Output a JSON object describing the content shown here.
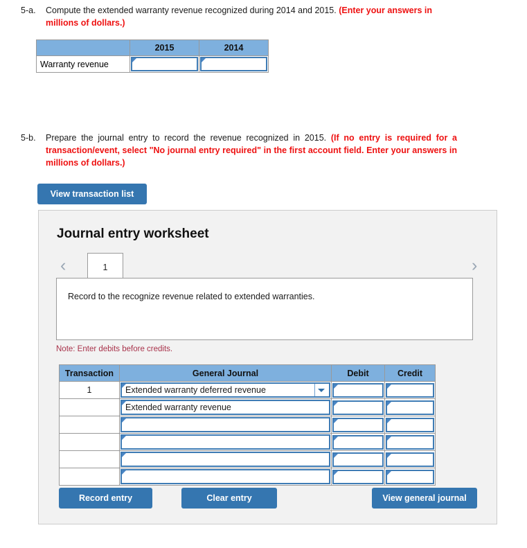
{
  "questions": {
    "q5a": {
      "label": "5-a.",
      "text": "Compute the extended warranty revenue recognized during 2014 and 2015. ",
      "instruction": "(Enter your answers in millions of dollars.)"
    },
    "q5b": {
      "label": "5-b.",
      "text": "Prepare the journal entry to record the revenue recognized in 2015. ",
      "instruction": "(If no entry is required for a transaction/event, select \"No journal entry required\" in the first account field. Enter your answers in millions of dollars.)"
    }
  },
  "warranty_table": {
    "corner_header": "",
    "headers": [
      "2015",
      "2014"
    ],
    "rows": [
      {
        "label": "Warranty revenue",
        "values": [
          "",
          ""
        ]
      }
    ]
  },
  "buttons": {
    "view_transaction_list": "View transaction list",
    "record_entry": "Record entry",
    "clear_entry": "Clear entry",
    "view_general_journal": "View general journal"
  },
  "worksheet": {
    "title": "Journal entry worksheet",
    "prev_icon": "‹",
    "next_icon": "›",
    "tabs": [
      "1"
    ],
    "active_tab": "1",
    "description": "Record to the recognize revenue related to extended warranties.",
    "note": "Note: Enter debits before credits."
  },
  "journal_table": {
    "headers": [
      "Transaction",
      "General Journal",
      "Debit",
      "Credit"
    ],
    "rows": [
      {
        "transaction": "1",
        "account": "Extended warranty deferred revenue",
        "has_dropdown": true,
        "debit": "",
        "credit": ""
      },
      {
        "transaction": "",
        "account": "Extended warranty revenue",
        "has_dropdown": false,
        "debit": "",
        "credit": ""
      },
      {
        "transaction": "",
        "account": "",
        "has_dropdown": false,
        "debit": "",
        "credit": ""
      },
      {
        "transaction": "",
        "account": "",
        "has_dropdown": false,
        "debit": "",
        "credit": ""
      },
      {
        "transaction": "",
        "account": "",
        "has_dropdown": false,
        "debit": "",
        "credit": ""
      },
      {
        "transaction": "",
        "account": "",
        "has_dropdown": false,
        "debit": "",
        "credit": ""
      }
    ]
  },
  "colors": {
    "header_blue": "#7eb0de",
    "button_blue": "#3576b0",
    "input_border_blue": "#3f7cb5",
    "instruction_red": "#ee1111",
    "note_red": "#a8324a",
    "panel_bg": "#f2f2f2"
  }
}
